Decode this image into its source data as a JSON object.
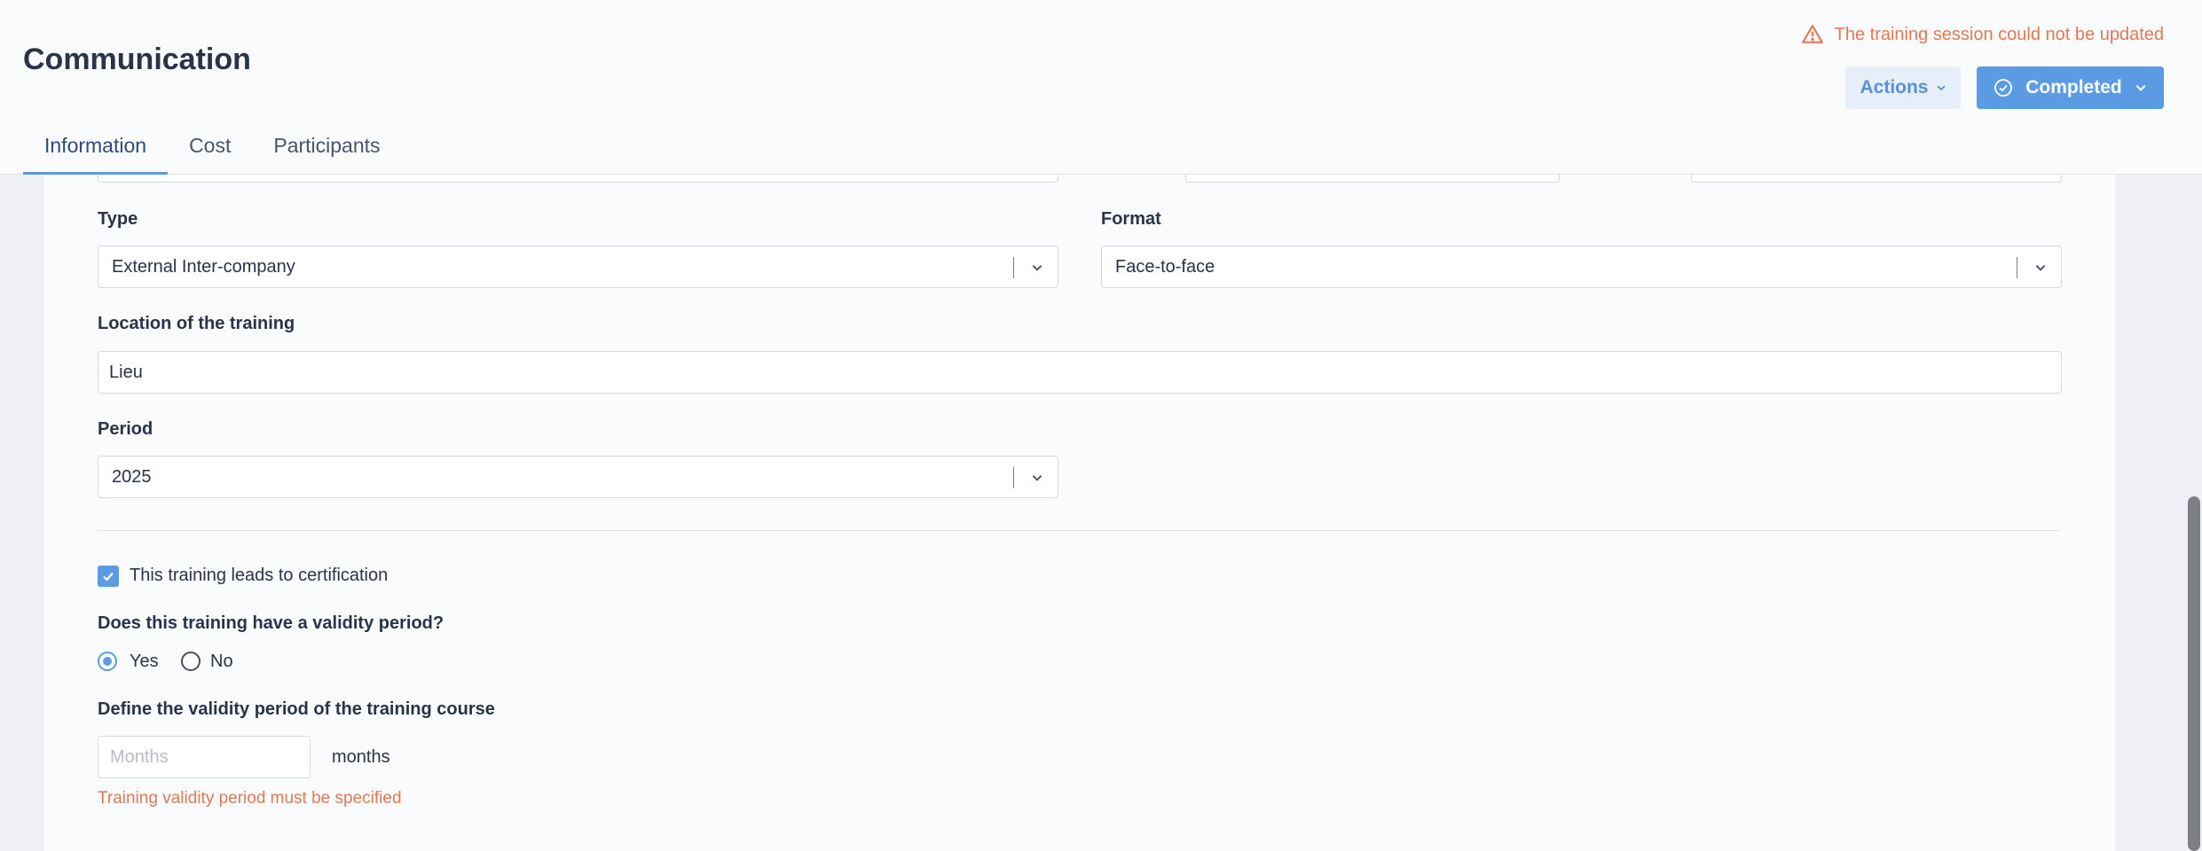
{
  "header": {
    "title": "Communication",
    "error_message": "The training session could not be updated",
    "actions_label": "Actions",
    "completed_label": "Completed",
    "tabs": [
      {
        "label": "Information",
        "active": true
      },
      {
        "label": "Cost",
        "active": false
      },
      {
        "label": "Participants",
        "active": false
      }
    ]
  },
  "form": {
    "type": {
      "label": "Type",
      "value": "External Inter-company"
    },
    "format": {
      "label": "Format",
      "value": "Face-to-face"
    },
    "location": {
      "label": "Location of the training",
      "value": "Lieu"
    },
    "period": {
      "label": "Period",
      "value": "2025"
    },
    "certification": {
      "label": "This training leads to certification",
      "checked": true
    },
    "validity_question": {
      "label": "Does this training have a validity period?",
      "options": [
        {
          "label": "Yes",
          "selected": true
        },
        {
          "label": "No",
          "selected": false
        }
      ]
    },
    "validity_period": {
      "label": "Define the validity period of the training course",
      "placeholder": "Months",
      "value": "",
      "unit": "months",
      "error": "Training validity period must be specified"
    }
  },
  "icons": {
    "warning": "warning-triangle-icon",
    "check_circle": "check-circle-icon",
    "chevron": "chevron-down-icon",
    "checkmark": "checkmark-icon"
  },
  "colors": {
    "accent": "#5b9be4",
    "error": "#e07a55",
    "text": "#2b3347"
  }
}
